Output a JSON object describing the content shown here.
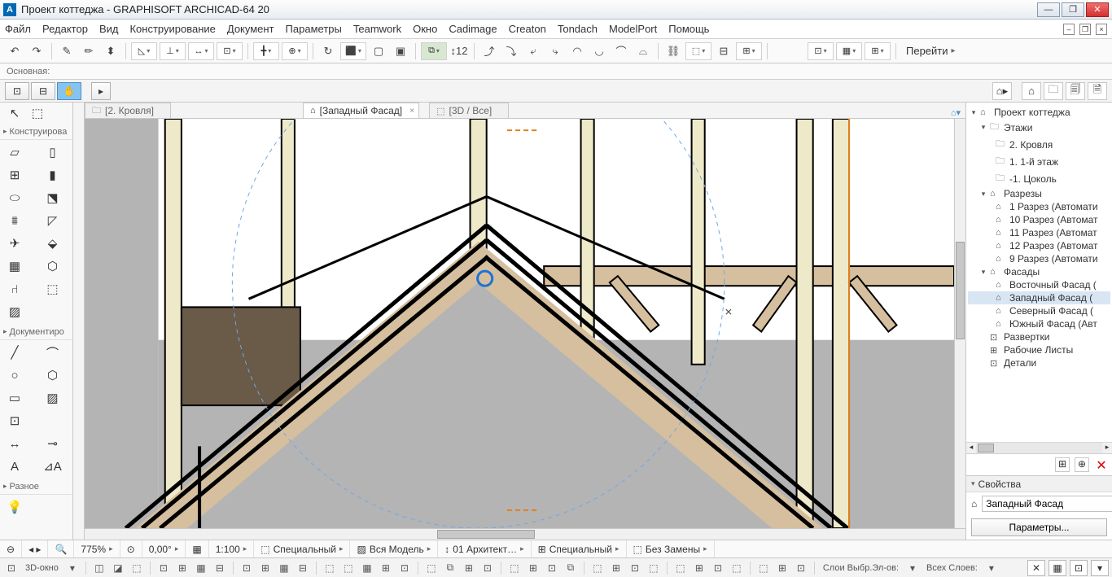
{
  "title": "Проект коттеджа - GRAPHISOFT ARCHICAD-64 20",
  "menu": [
    "Файл",
    "Редактор",
    "Вид",
    "Конструирование",
    "Документ",
    "Параметры",
    "Teamwork",
    "Окно",
    "Cadimage",
    "Creaton",
    "Tondach",
    "ModelPort",
    "Помощь"
  ],
  "sub_label": "Основная:",
  "goto_label": "Перейти",
  "toolbox": {
    "sec1": "Конструирова",
    "sec2": "Документиро",
    "sec3": "Разное"
  },
  "tabs": [
    {
      "label": "[2. Кровля]",
      "icon": "📁",
      "active": false
    },
    {
      "label": "[Западный Фасад]",
      "icon": "⌂",
      "active": true
    },
    {
      "label": "[3D / Все]",
      "icon": "⬚",
      "active": false
    }
  ],
  "navigator": {
    "root": "Проект коттеджа",
    "stories_label": "Этажи",
    "stories": [
      "2. Кровля",
      "1. 1-й этаж",
      "-1. Цоколь"
    ],
    "sections_label": "Разрезы",
    "sections": [
      "1 Разрез (Автомати",
      "10 Разрез (Автомат",
      "11 Разрез (Автомат",
      "12 Разрез (Автомат",
      "9 Разрез (Автомати"
    ],
    "elevations_label": "Фасады",
    "elevations": [
      "Восточный Фасад (",
      "Западный Фасад (",
      "Северный Фасад (",
      "Южный Фасад (Авт"
    ],
    "elevation_selected": 1,
    "interior_label": "Развертки",
    "worksheets_label": "Рабочие Листы",
    "details_label": "Детали"
  },
  "props": {
    "title": "Свойства",
    "value": "Западный Фасад",
    "button": "Параметры..."
  },
  "status1": {
    "zoom": "775%",
    "angle": "0,00°",
    "scale": "1:100",
    "combo1": "Специальный",
    "combo2": "Вся Модель",
    "combo3": "01 Архитект…",
    "combo4": "Специальный",
    "combo5": "Без Замены"
  },
  "status2": {
    "view_label": "3D-окно",
    "layers1": "Слои Выбр.Эл-ов:",
    "layers2": "Всех Слоев:"
  }
}
